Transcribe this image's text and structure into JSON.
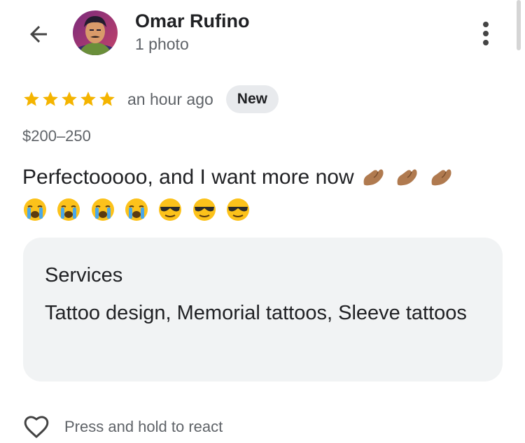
{
  "header": {
    "back_icon": "arrow-left-icon",
    "user_name": "Omar Rufino",
    "user_sub": "1 photo",
    "more_icon": "more-vertical-icon"
  },
  "review": {
    "rating": 5,
    "rating_max": 5,
    "star_color": "#f4b400",
    "time": "an hour ago",
    "badge": "New",
    "price": "$200–250",
    "text": "Perfectooooo, and I want more now",
    "emojis": [
      "pinching-hand-emoji",
      "pinching-hand-emoji",
      "pinching-hand-emoji",
      "crying-face-emoji",
      "crying-face-emoji",
      "crying-face-emoji",
      "crying-face-emoji",
      "sunglasses-face-emoji",
      "sunglasses-face-emoji",
      "sunglasses-face-emoji"
    ]
  },
  "services": {
    "title": "Services",
    "list": "Tattoo design, Memorial tattoos, Sleeve tattoos"
  },
  "react": {
    "icon": "heart-outline-icon",
    "label": "Press and hold to react"
  }
}
